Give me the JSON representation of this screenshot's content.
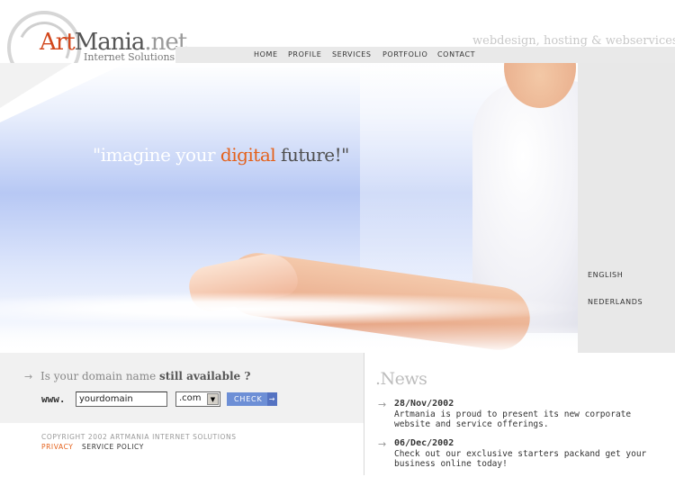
{
  "header": {
    "logo_art": "Art",
    "logo_mania": "Mania",
    "logo_net": ".net",
    "logo_sub": "Internet Solutions",
    "tagline": "webdesign, hosting & webservices"
  },
  "nav": {
    "items": [
      "HOME",
      "PROFILE",
      "SERVICES",
      "PORTFOLIO",
      "CONTACT"
    ]
  },
  "hero": {
    "quote_part1": "\"imagine your ",
    "quote_part2": "digital",
    "quote_part3": " future!\""
  },
  "side": {
    "languages": [
      "ENGLISH",
      "NEDERLANDS"
    ]
  },
  "domain": {
    "question_part1": "Is your domain name ",
    "question_part2": "still available ?",
    "www_label": "www.",
    "input_value": "yourdomain",
    "tld_selected": ".com",
    "check_label": "CHECK"
  },
  "footer": {
    "copyright": "COPYRIGHT 2002  ARTMANIA INTERNET SOLUTIONS",
    "privacy": "PRIVACY",
    "service_policy": "SERVICE POLICY"
  },
  "news": {
    "title": ".News",
    "items": [
      {
        "date": "28/Nov/2002",
        "text": "Artmania is proud to present its new corporate website and service offerings."
      },
      {
        "date": "06/Dec/2002",
        "text": "Check out our exclusive starters packand get your business online today!"
      }
    ]
  },
  "colors": {
    "accent_orange": "#e4611b",
    "logo_orange": "#d2471c",
    "nav_bar": "#e9e9e9",
    "check_button": "#6d8fd6",
    "side_panel": "#e8e8e8"
  },
  "icons": {
    "bullet": "arrow-bullet-icon",
    "select_arrow": "chevron-down-icon",
    "button_arrow": "arrow-right-icon"
  }
}
